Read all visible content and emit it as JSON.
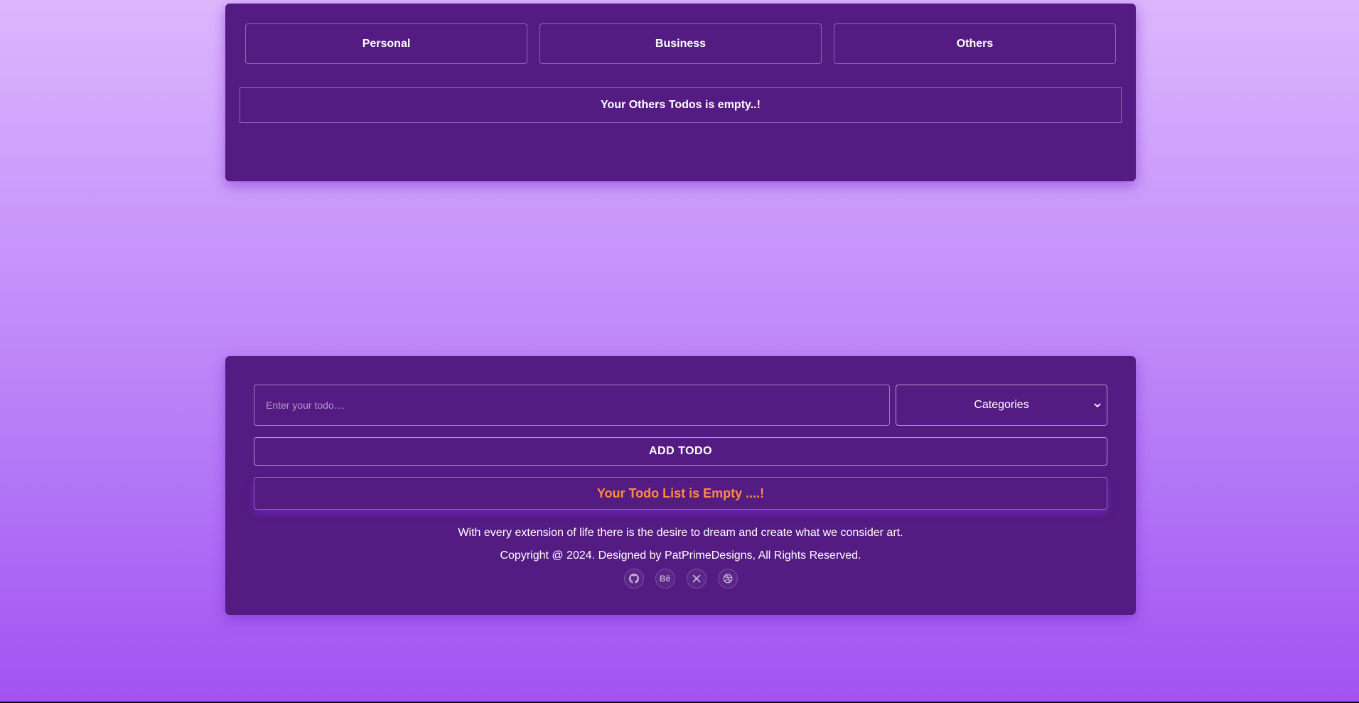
{
  "categories": {
    "tabs": [
      {
        "label": "Personal"
      },
      {
        "label": "Business"
      },
      {
        "label": "Others"
      }
    ],
    "empty_message": "Your Others Todos is empty..!"
  },
  "todo_form": {
    "input": {
      "placeholder": "Enter your todo....",
      "value": ""
    },
    "select": {
      "selected": "Categories"
    },
    "add_button_label": "ADD TODO",
    "empty_list_message": "Your Todo List is Empty ....!"
  },
  "footer": {
    "tagline": "With every extension of life there is the desire to dream and create what we consider art.",
    "copyright": "Copyright @ 2024. Designed by PatPrimeDesigns, All Rights Reserved.",
    "socials": [
      {
        "icon": "github-icon"
      },
      {
        "icon": "behance-icon",
        "glyph": "Bē"
      },
      {
        "icon": "x-twitter-icon"
      },
      {
        "icon": "dribbble-icon"
      }
    ]
  },
  "colors": {
    "panel": "#541b83",
    "empty_text": "#fd8c3d",
    "bg_top": "#dcb6fd",
    "bg_bottom": "#a252f2"
  }
}
